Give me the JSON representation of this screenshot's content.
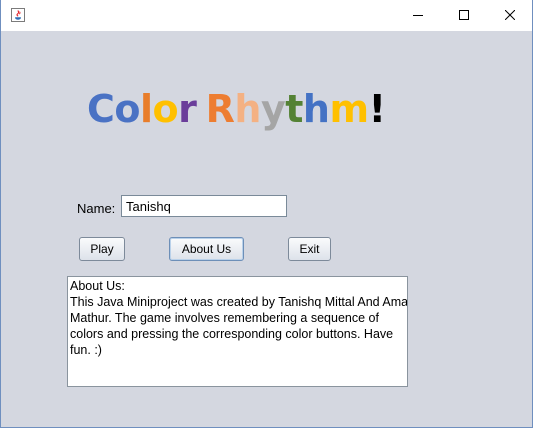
{
  "window": {
    "controls": {
      "minimize_icon": "minimize-icon",
      "maximize_icon": "maximize-icon",
      "close_icon": "close-icon"
    }
  },
  "logo": {
    "letters": [
      {
        "char": "C",
        "color": "#4a72c4"
      },
      {
        "char": "o",
        "color": "#4a72c4"
      },
      {
        "char": "l",
        "color": "#e87d2a"
      },
      {
        "char": "o",
        "color": "#ffc000"
      },
      {
        "char": "r",
        "color": "#6a3d9a"
      },
      {
        "char": " ",
        "color": "#000000"
      },
      {
        "char": "R",
        "color": "#ed7d31"
      },
      {
        "char": "h",
        "color": "#f4b183"
      },
      {
        "char": "y",
        "color": "#a5a5a5"
      },
      {
        "char": "t",
        "color": "#548235"
      },
      {
        "char": "h",
        "color": "#4472c4"
      },
      {
        "char": "m",
        "color": "#ffc000"
      },
      {
        "char": "!",
        "color": "#000000"
      }
    ]
  },
  "form": {
    "name_label": "Name:",
    "name_value": "Tanishq"
  },
  "buttons": {
    "play": "Play",
    "about": "About Us",
    "exit": "Exit"
  },
  "about": {
    "lines": [
      "About Us:",
      "This Java Miniproject was created by Tanishq Mittal And Aman",
      "Mathur. The game involves remembering a sequence of",
      "colors and pressing the corresponding color buttons. Have",
      "fun. :)"
    ]
  }
}
